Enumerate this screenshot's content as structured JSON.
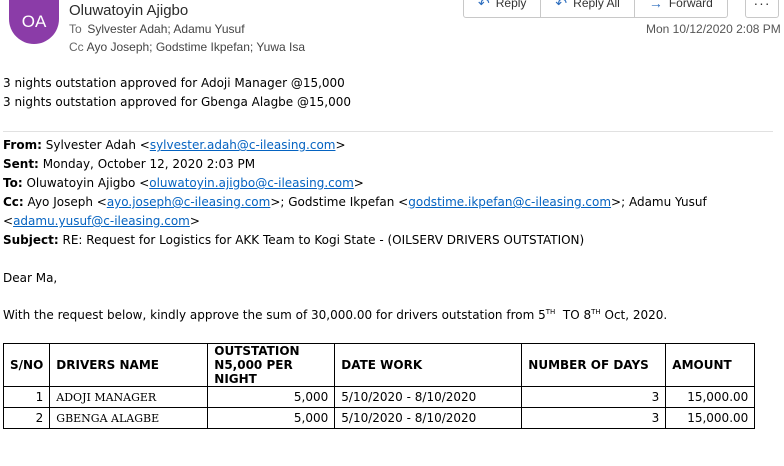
{
  "header": {
    "avatar_initials": "OA",
    "sender": "Oluwatoyin Ajigbo",
    "to_label": "To",
    "to_value": "Sylvester Adah; Adamu Yusuf",
    "cc_label": "Cc",
    "cc_value": "Ayo Joseph; Godstime Ikpefan; Yuwa Isa",
    "date": "Mon 10/12/2020 2:08 PM",
    "actions": [
      {
        "label": "Reply",
        "icon": "reply-icon"
      },
      {
        "label": "Reply All",
        "icon": "reply-all-icon"
      },
      {
        "label": "Forward",
        "icon": "forward-icon"
      }
    ],
    "more": "···"
  },
  "body": {
    "line1": "3 nights outstation approved for Adoji Manager @15,000",
    "line2": "3 nights outstation approved for Gbenga Alagbe @15,000",
    "quoted": {
      "from_label": "From:",
      "from_name": "Sylvester Adah <",
      "from_email": "sylvester.adah@c-ileasing.com",
      "sent_label": "Sent:",
      "sent_value": "Monday, October 12, 2020 2:03 PM",
      "to_label": "To:",
      "to_name": "Oluwatoyin Ajigbo <",
      "to_email": "oluwatoyin.ajigbo@c-ileasing.com",
      "cc_label": "Cc:",
      "cc_name1": "Ayo Joseph <",
      "cc_email1": "ayo.joseph@c-ileasing.com",
      "cc_name2": ">; Godstime Ikpefan <",
      "cc_email2": "godstime.ikpefan@c-ileasing.com",
      "cc_name3": ">; Adamu Yusuf",
      "cc_email3": "adamu.yusuf@c-ileasing.com",
      "subject_label": "Subject:",
      "subject_value": "RE: Request for Logistics for AKK Team to Kogi State - (OILSERV DRIVERS OUTSTATION)"
    },
    "greeting": "Dear Ma,",
    "request_part1": "With the request below, kindly approve the sum of 30,000.00 for drivers outstation from 5",
    "request_sup1": "TH",
    "request_part2": "  TO 8",
    "request_sup2": "TH",
    "request_part3": " Oct, 2020."
  },
  "table": {
    "headers": [
      "S/NO",
      "DRIVERS NAME",
      "OUTSTATION N5,000 PER NIGHT",
      "DATE WORK",
      "NUMBER OF DAYS",
      "AMOUNT"
    ],
    "rows": [
      {
        "sn": "1",
        "name": "ADOJI MANAGER",
        "outstation": "5,000",
        "date": "5/10/2020 - 8/10/2020",
        "days": "3",
        "amount": "15,000.00"
      },
      {
        "sn": "2",
        "name": "GBENGA ALAGBE",
        "outstation": "5,000",
        "date": "5/10/2020 - 8/10/2020",
        "days": "3",
        "amount": "15,000.00"
      }
    ]
  }
}
